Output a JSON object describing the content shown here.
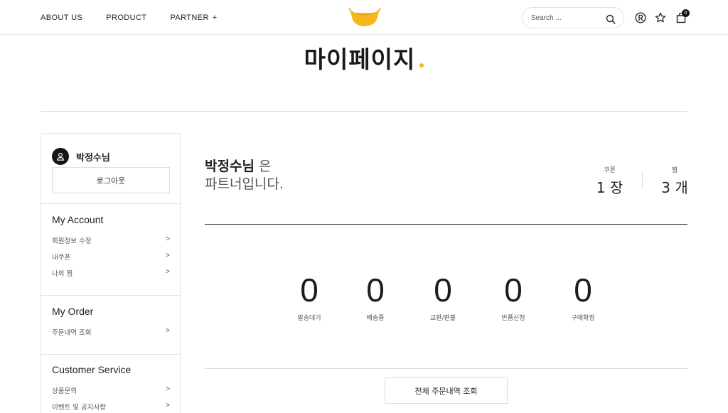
{
  "header": {
    "nav": [
      {
        "label": "ABOUT US"
      },
      {
        "label": "PRODUCT"
      },
      {
        "label": "PARTNER"
      }
    ],
    "partner_plus": "+",
    "logo_icon": "basket-logo-icon",
    "search": {
      "placeholder": "Search ..."
    },
    "cart_count": "0",
    "brand_color": "#f5b71b"
  },
  "page": {
    "title": "마이페이지"
  },
  "sidebar": {
    "user_name": "박정수님",
    "logout_label": "로그아웃",
    "sections": [
      {
        "heading": "My Account",
        "links": [
          {
            "label": "회원정보 수정",
            "chevron": ">"
          },
          {
            "label": "내쿠폰",
            "chevron": ">"
          },
          {
            "label": "나의 찜",
            "chevron": ">"
          }
        ]
      },
      {
        "heading": "My Order",
        "links": [
          {
            "label": "주문내역 조회",
            "chevron": ">"
          }
        ]
      },
      {
        "heading": "Customer Service",
        "links": [
          {
            "label": "상품문의",
            "chevron": ">"
          },
          {
            "label": "이벤트 및 공지사항",
            "chevron": ">"
          }
        ]
      }
    ]
  },
  "main": {
    "greeting_name": "박정수님",
    "greeting_suffix": " 은",
    "greeting_line2": "파트너입니다.",
    "stats": [
      {
        "label": "쿠폰",
        "value": "1 장"
      },
      {
        "label": "찜",
        "value": "3 개"
      }
    ],
    "order_status": [
      {
        "count": "0",
        "label": "발송대기"
      },
      {
        "count": "0",
        "label": "배송중"
      },
      {
        "count": "0",
        "label": "교환/환불"
      },
      {
        "count": "0",
        "label": "반품신청"
      },
      {
        "count": "0",
        "label": "구매확정"
      }
    ],
    "all_orders_label": "전체 주문내역 조회"
  }
}
